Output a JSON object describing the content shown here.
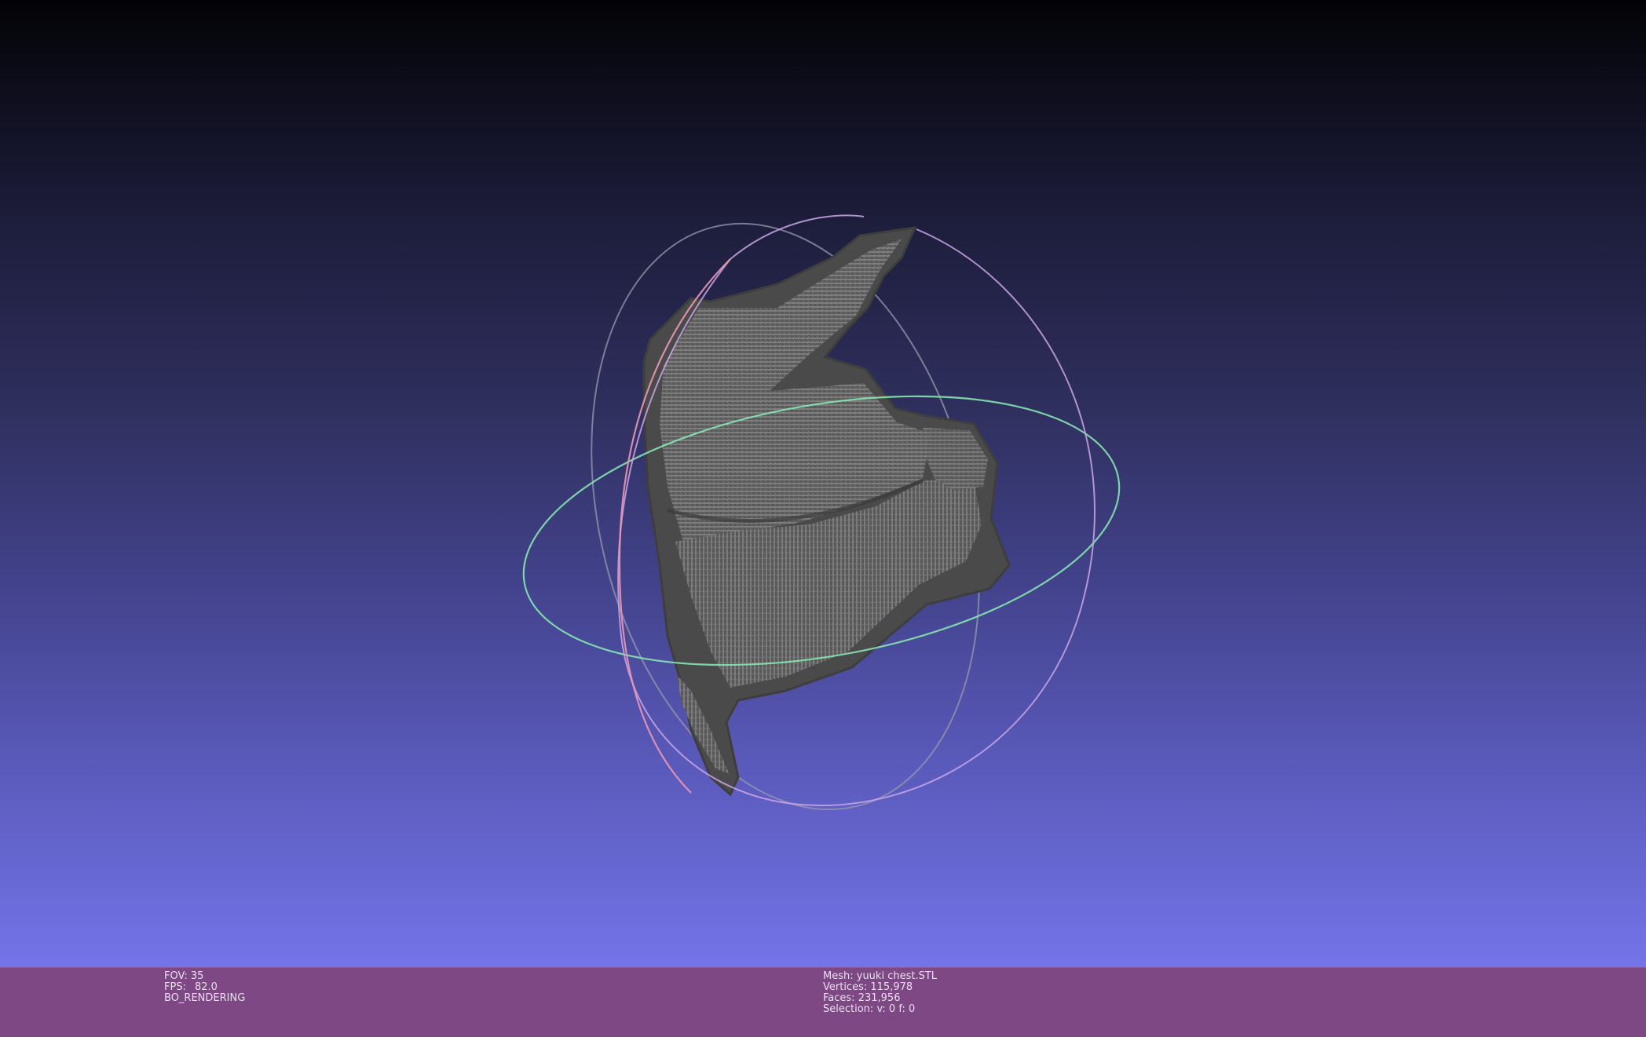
{
  "viewport": {
    "background_top": "#030306",
    "background_bottom": "#7474e9",
    "mesh_color": "#4a4a4a",
    "trackball_colors": {
      "horizontal_ring": "#86e3b0",
      "vertical_ring_a": "#ea97b4",
      "vertical_ring_b": "#b9a9ee"
    }
  },
  "status_bar": {
    "background": "#7e4884",
    "left": {
      "fov_label": "FOV:",
      "fov_value": "35",
      "fps_label": "FPS:",
      "fps_value": "82.0",
      "render_mode": "BO_RENDERING"
    },
    "right": {
      "mesh_label": "Mesh:",
      "mesh_value": "yuuki chest.STL",
      "vertices_label": "Vertices:",
      "vertices_value": "115,978",
      "faces_label": "Faces:",
      "faces_value": "231,956",
      "selection_label": "Selection:",
      "selection_value": "v: 0 f: 0"
    }
  }
}
